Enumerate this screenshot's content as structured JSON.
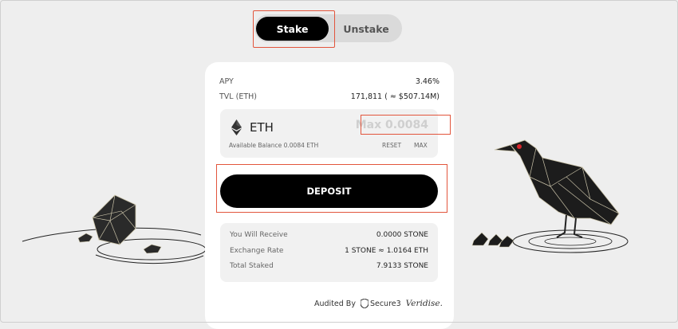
{
  "tabs": {
    "stake": "Stake",
    "unstake": "Unstake"
  },
  "stats": {
    "apy_label": "APY",
    "apy_value": "3.46%",
    "tvl_label": "TVL (ETH)",
    "tvl_value": "171,811 ( ≈ $507.14M)"
  },
  "input": {
    "token": "ETH",
    "placeholder": "Max 0.0084",
    "balance": "Available Balance 0.0084 ETH",
    "reset": "RESET",
    "max": "MAX"
  },
  "deposit_label": "DEPOSIT",
  "summary": [
    {
      "label": "You Will Receive",
      "value": "0.0000 STONE"
    },
    {
      "label": "Exchange Rate",
      "value": "1 STONE ≈ 1.0164 ETH"
    },
    {
      "label": "Total Staked",
      "value": "7.9133 STONE"
    }
  ],
  "audit": {
    "label": "Audited By",
    "secure": "Secure3",
    "veridise": "Veridise."
  },
  "colors": {
    "highlight": "#e2553c",
    "accent": "#000000",
    "bird_eye": "#d9262b"
  }
}
